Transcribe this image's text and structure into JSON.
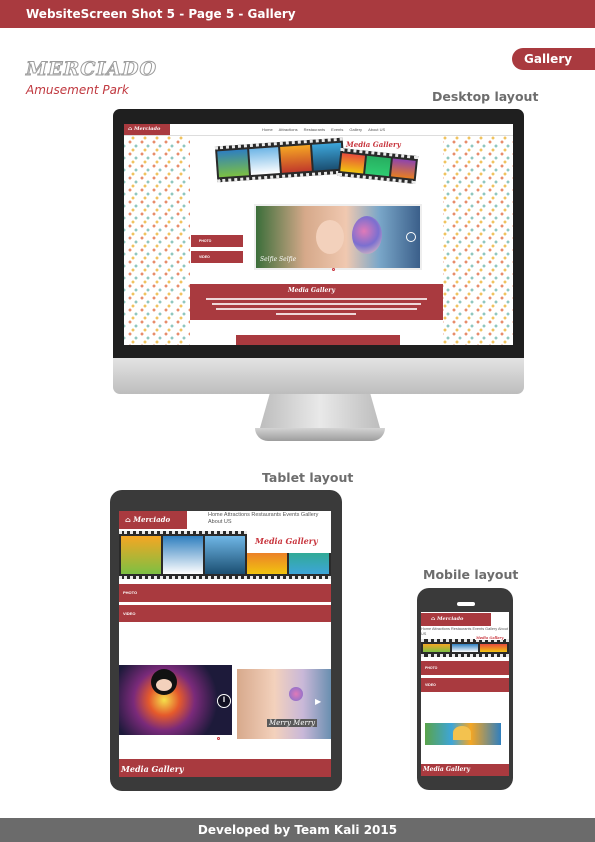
{
  "header": {
    "title": "WebsiteScreen Shot 5 -  Page 5  -  Gallery"
  },
  "tag": {
    "label": "Gallery"
  },
  "brand": {
    "name": "MERCIADO",
    "subtitle": "Amusement Park"
  },
  "labels": {
    "desktop": "Desktop layout",
    "tablet": "Tablet layout",
    "mobile": "Mobile layout"
  },
  "site": {
    "logo": "Merciado",
    "nav": [
      "Home",
      "Attractions",
      "Restaurants",
      "Events",
      "Gallery",
      "About US"
    ],
    "nav_line1": "Home  Attractions  Restaurants  Events  Gallery",
    "nav_line2": "About US",
    "mobile_nav": "Home Attractions Restaurants Events Gallery About US",
    "media_gallery": "Media Gallery",
    "photo": "PHOTO",
    "video": "VIDEO",
    "slide_caption_desktop": "Selfie Selfie",
    "slide_caption_tablet": "Merry Merry"
  },
  "footer": {
    "text": "Developed by Team Kali 2015"
  },
  "colors": {
    "brand_red": "#a93a3f",
    "dark_device": "#1f1f1f",
    "footer_gray": "#6b6b6b"
  }
}
